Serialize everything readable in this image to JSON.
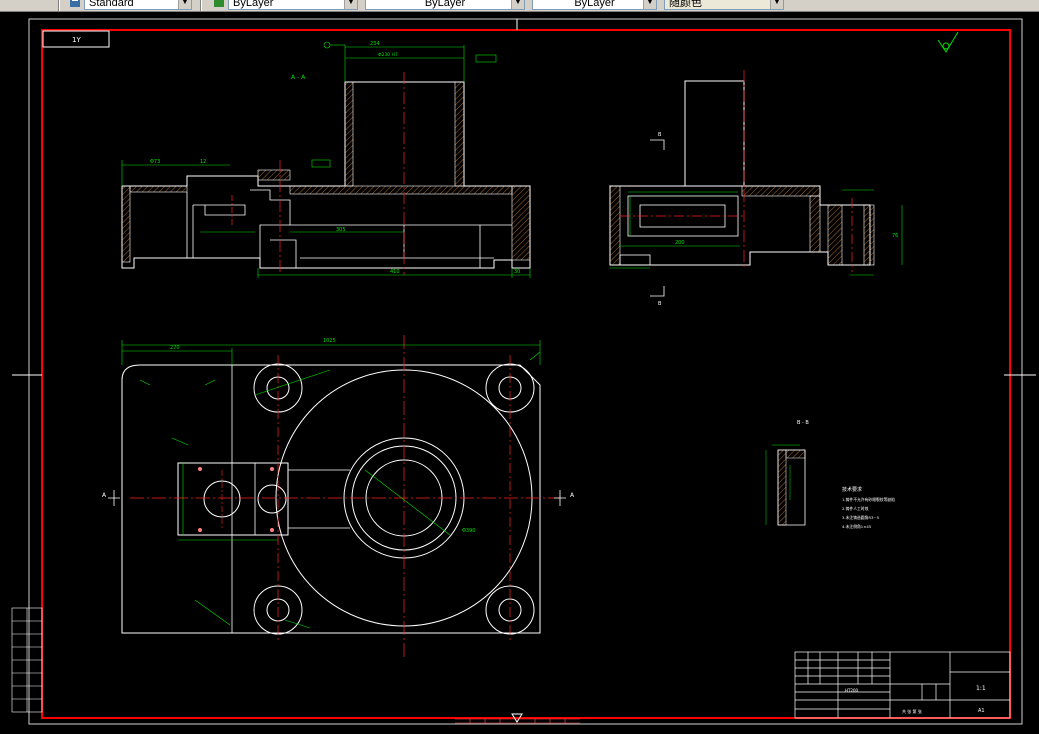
{
  "toolbar": {
    "text_style": "Standard",
    "layer": "ByLayer",
    "linetype": "ByLayer",
    "lineweight": "ByLayer",
    "plot_style": "随颜色"
  },
  "drawing": {
    "title_stamp": "1Y",
    "section_aa": "A - A",
    "section_bb_top": "B",
    "section_bb_bottom": "B",
    "section_bb_label": "B - B",
    "cut_a_left": "A",
    "cut_a_right": "A",
    "dims": {
      "top_234": "234",
      "top_phi": "Φ230 H7",
      "left_phi73": "Φ73",
      "d_12": "12",
      "d_305": "305",
      "d_410": "410",
      "d_30": "30",
      "plan_1025": "1025",
      "plan_270": "270",
      "phi_bore": "Φ390",
      "side_200": "200",
      "side_76": "76"
    },
    "notes": {
      "heading": "技术要求",
      "items": [
        "1.铸件不允许有砂眼裂纹等缺陷",
        "2.铸件人工时效",
        "3.未注铸造圆角R3~5",
        "4.未注倒角1×45"
      ]
    },
    "title_block": {
      "material": "HT200",
      "sheet_no": "A1",
      "scale": "1:1",
      "sheet_info": "共 张 第 张"
    }
  }
}
